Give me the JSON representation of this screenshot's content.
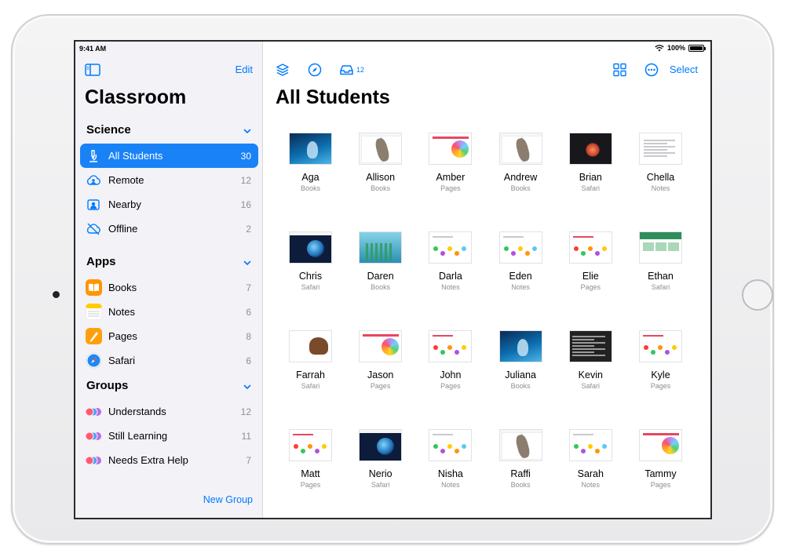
{
  "status": {
    "time": "9:41 AM",
    "battery": "100%",
    "battery_level": 1.0
  },
  "sidebar": {
    "edit_label": "Edit",
    "title": "Classroom",
    "sections": [
      {
        "title": "Science",
        "rows": [
          {
            "label": "All Students",
            "count": "30",
            "icon": "microscope-icon",
            "selected": true
          },
          {
            "label": "Remote",
            "count": "12",
            "icon": "cloud-person-icon"
          },
          {
            "label": "Nearby",
            "count": "16",
            "icon": "person-square-icon"
          },
          {
            "label": "Offline",
            "count": "2",
            "icon": "cloud-slash-icon"
          }
        ]
      },
      {
        "title": "Apps",
        "rows": [
          {
            "label": "Books",
            "count": "7",
            "icon": "books-app-icon",
            "color": "#ff9500"
          },
          {
            "label": "Notes",
            "count": "6",
            "icon": "notes-app-icon",
            "color": "#ffcc00"
          },
          {
            "label": "Pages",
            "count": "8",
            "icon": "pages-app-icon",
            "color": "#ff9f0a"
          },
          {
            "label": "Safari",
            "count": "6",
            "icon": "safari-app-icon",
            "color": "#1e88f5"
          }
        ]
      },
      {
        "title": "Groups",
        "rows": [
          {
            "label": "Understands",
            "count": "12",
            "icon": "group-avatars-icon"
          },
          {
            "label": "Still Learning",
            "count": "11",
            "icon": "group-avatars-icon"
          },
          {
            "label": "Needs Extra Help",
            "count": "7",
            "icon": "group-avatars-icon"
          }
        ]
      }
    ],
    "new_group_label": "New Group"
  },
  "toolbar": {
    "inbox_count": "12",
    "select_label": "Select"
  },
  "main": {
    "title": "All Students",
    "students": [
      {
        "name": "Aga",
        "app": "Books",
        "thumb": "blue"
      },
      {
        "name": "Allison",
        "app": "Books",
        "thumb": "bio"
      },
      {
        "name": "Amber",
        "app": "Pages",
        "thumb": "pages"
      },
      {
        "name": "Andrew",
        "app": "Books",
        "thumb": "bio"
      },
      {
        "name": "Brian",
        "app": "Safari",
        "thumb": "dark"
      },
      {
        "name": "Chella",
        "app": "Notes",
        "thumb": "notes"
      },
      {
        "name": "Chris",
        "app": "Safari",
        "thumb": "safari"
      },
      {
        "name": "Daren",
        "app": "Books",
        "thumb": "sea"
      },
      {
        "name": "Darla",
        "app": "Notes",
        "thumb": "dots"
      },
      {
        "name": "Eden",
        "app": "Notes",
        "thumb": "dots"
      },
      {
        "name": "Elie",
        "app": "Pages",
        "thumb": "dotsred"
      },
      {
        "name": "Ethan",
        "app": "Safari",
        "thumb": "green"
      },
      {
        "name": "Farrah",
        "app": "Safari",
        "thumb": "mammoth"
      },
      {
        "name": "Jason",
        "app": "Pages",
        "thumb": "pages"
      },
      {
        "name": "John",
        "app": "Pages",
        "thumb": "dotsred"
      },
      {
        "name": "Juliana",
        "app": "Books",
        "thumb": "blue"
      },
      {
        "name": "Kevin",
        "app": "Safari",
        "thumb": "kevin"
      },
      {
        "name": "Kyle",
        "app": "Pages",
        "thumb": "dotsred"
      },
      {
        "name": "Matt",
        "app": "Pages",
        "thumb": "dotsred"
      },
      {
        "name": "Nerio",
        "app": "Safari",
        "thumb": "safari"
      },
      {
        "name": "Nisha",
        "app": "Notes",
        "thumb": "dots"
      },
      {
        "name": "Raffi",
        "app": "Books",
        "thumb": "bio"
      },
      {
        "name": "Sarah",
        "app": "Notes",
        "thumb": "dots"
      },
      {
        "name": "Tammy",
        "app": "Pages",
        "thumb": "pages"
      }
    ]
  },
  "colors": {
    "accent": "#007aff",
    "selected": "#1a82f7",
    "sidebar_bg": "#f2f2f7"
  }
}
